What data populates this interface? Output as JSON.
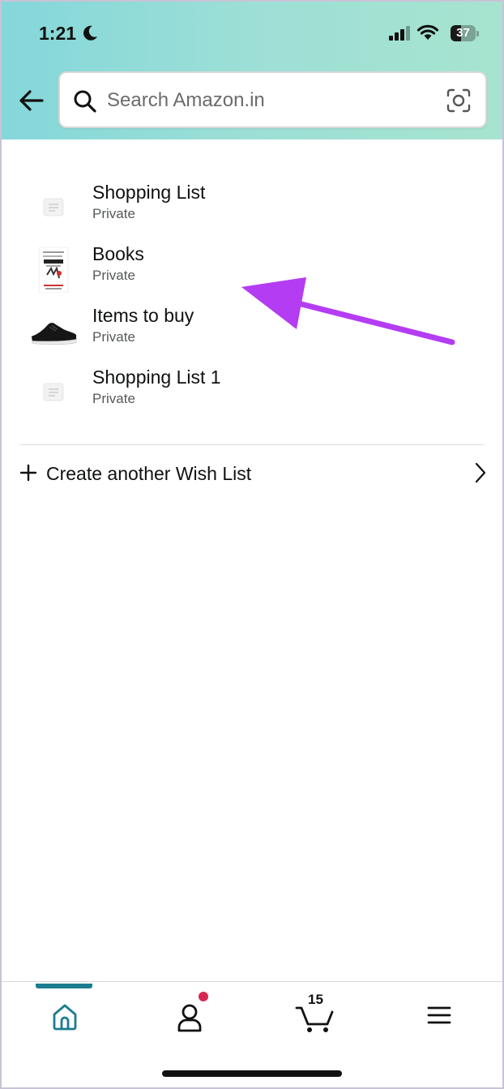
{
  "status_bar": {
    "time": "1:21",
    "battery": "37"
  },
  "search": {
    "placeholder": "Search Amazon.in"
  },
  "wishlists": [
    {
      "name": "Shopping List",
      "privacy": "Private",
      "thumbnail": "placeholder-list-icon"
    },
    {
      "name": "Books",
      "privacy": "Private",
      "thumbnail": "book-cover-image"
    },
    {
      "name": "Items to buy",
      "privacy": "Private",
      "thumbnail": "shoe-image"
    },
    {
      "name": "Shopping List 1",
      "privacy": "Private",
      "thumbnail": "placeholder-list-icon"
    }
  ],
  "create_list": {
    "label": "Create another Wish List"
  },
  "bottom_nav": {
    "cart_count": "15",
    "active_tab": "home"
  },
  "colors": {
    "header_gradient_start": "#84d7da",
    "header_gradient_end": "#a7e4cf",
    "annotation_arrow": "#b43cf2",
    "active_tab": "#1b7d8f",
    "notification_dot": "#d6274f"
  }
}
